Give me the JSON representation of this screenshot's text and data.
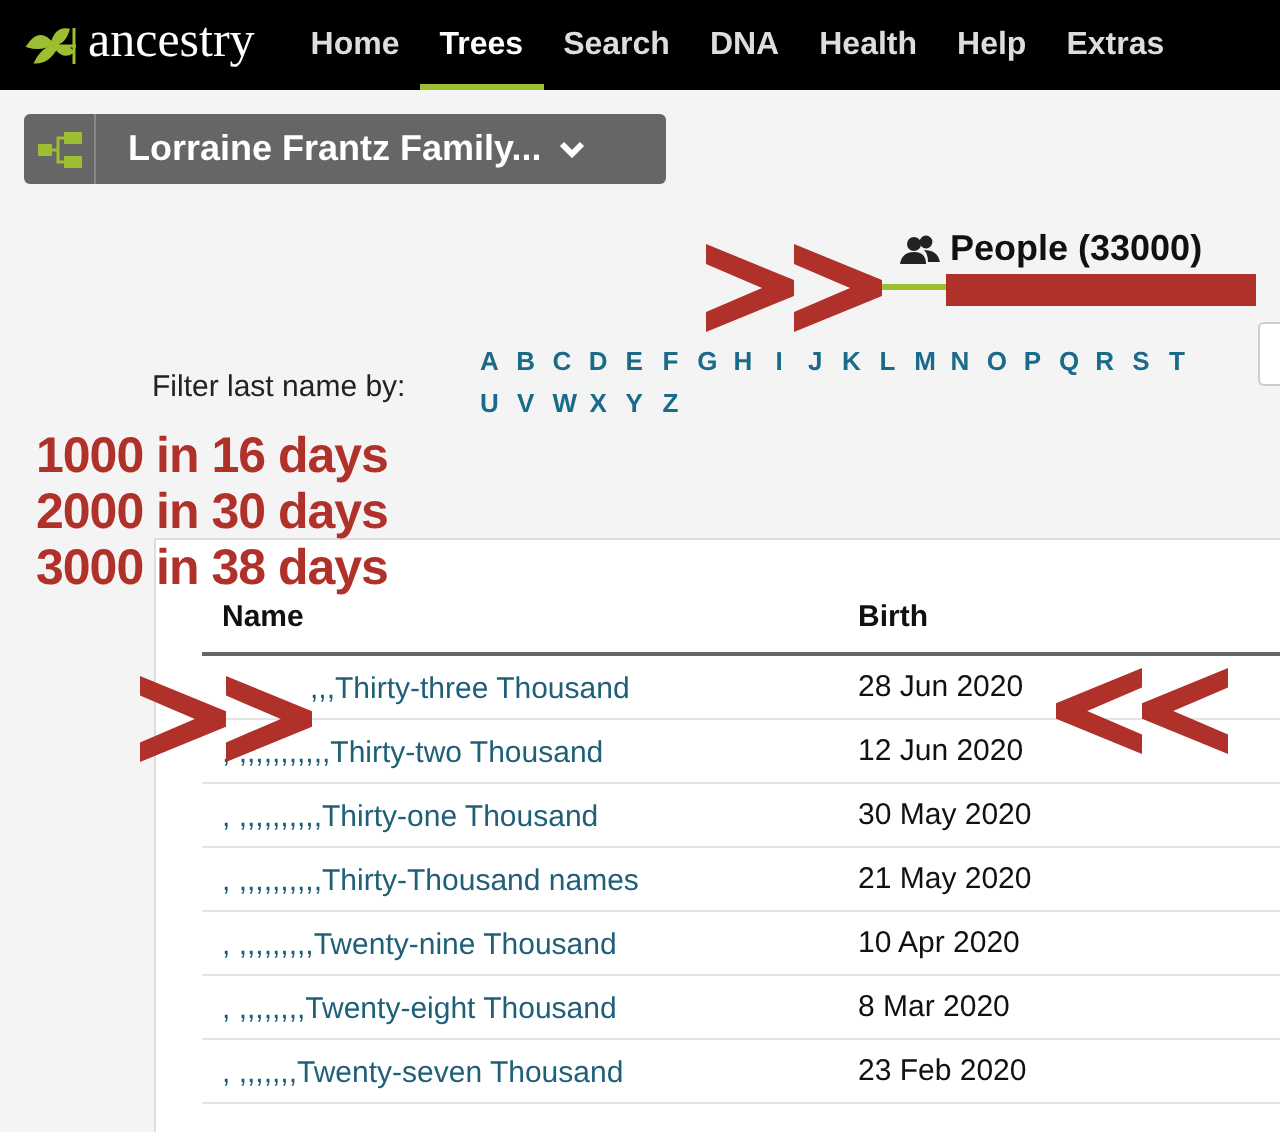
{
  "nav": {
    "logo": "ancestry",
    "items": [
      {
        "label": "Home",
        "selected": false
      },
      {
        "label": "Trees",
        "selected": true
      },
      {
        "label": "Search",
        "selected": false
      },
      {
        "label": "DNA",
        "selected": false
      },
      {
        "label": "Health",
        "selected": false
      },
      {
        "label": "Help",
        "selected": false
      },
      {
        "label": "Extras",
        "selected": false
      }
    ]
  },
  "tree_selector": {
    "label": "Lorraine Frantz Family..."
  },
  "people": {
    "label": "People (33000)"
  },
  "filter": {
    "label": "Filter last name by:",
    "letters": [
      "A",
      "B",
      "C",
      "D",
      "E",
      "F",
      "G",
      "H",
      "I",
      "J",
      "K",
      "L",
      "M",
      "N",
      "O",
      "P",
      "Q",
      "R",
      "S",
      "T",
      "U",
      "V",
      "W",
      "X",
      "Y",
      "Z"
    ]
  },
  "annotation": {
    "lines": [
      "1000 in 16 days",
      "2000 in 30 days",
      "3000 in 38 days"
    ]
  },
  "table": {
    "columns": [
      "Name",
      "Birth"
    ],
    "rows": [
      {
        "name": ",,,Thirty-three Thousand",
        "birth": "28 Jun 2020",
        "covered": true
      },
      {
        "name": ", ,,,,,,,,,,,Thirty-two Thousand",
        "birth": "12 Jun 2020",
        "covered": false
      },
      {
        "name": ", ,,,,,,,,,,Thirty-one Thousand",
        "birth": "30 May 2020",
        "covered": false
      },
      {
        "name": ", ,,,,,,,,,,Thirty-Thousand names",
        "birth": "21 May 2020",
        "covered": false
      },
      {
        "name": ", ,,,,,,,,,Twenty-nine Thousand",
        "birth": "10 Apr 2020",
        "covered": false
      },
      {
        "name": ", ,,,,,,,,Twenty-eight Thousand",
        "birth": "8 Mar 2020",
        "covered": false
      },
      {
        "name": ", ,,,,,,,Twenty-seven Thousand",
        "birth": "23 Feb 2020",
        "covered": false
      }
    ]
  }
}
